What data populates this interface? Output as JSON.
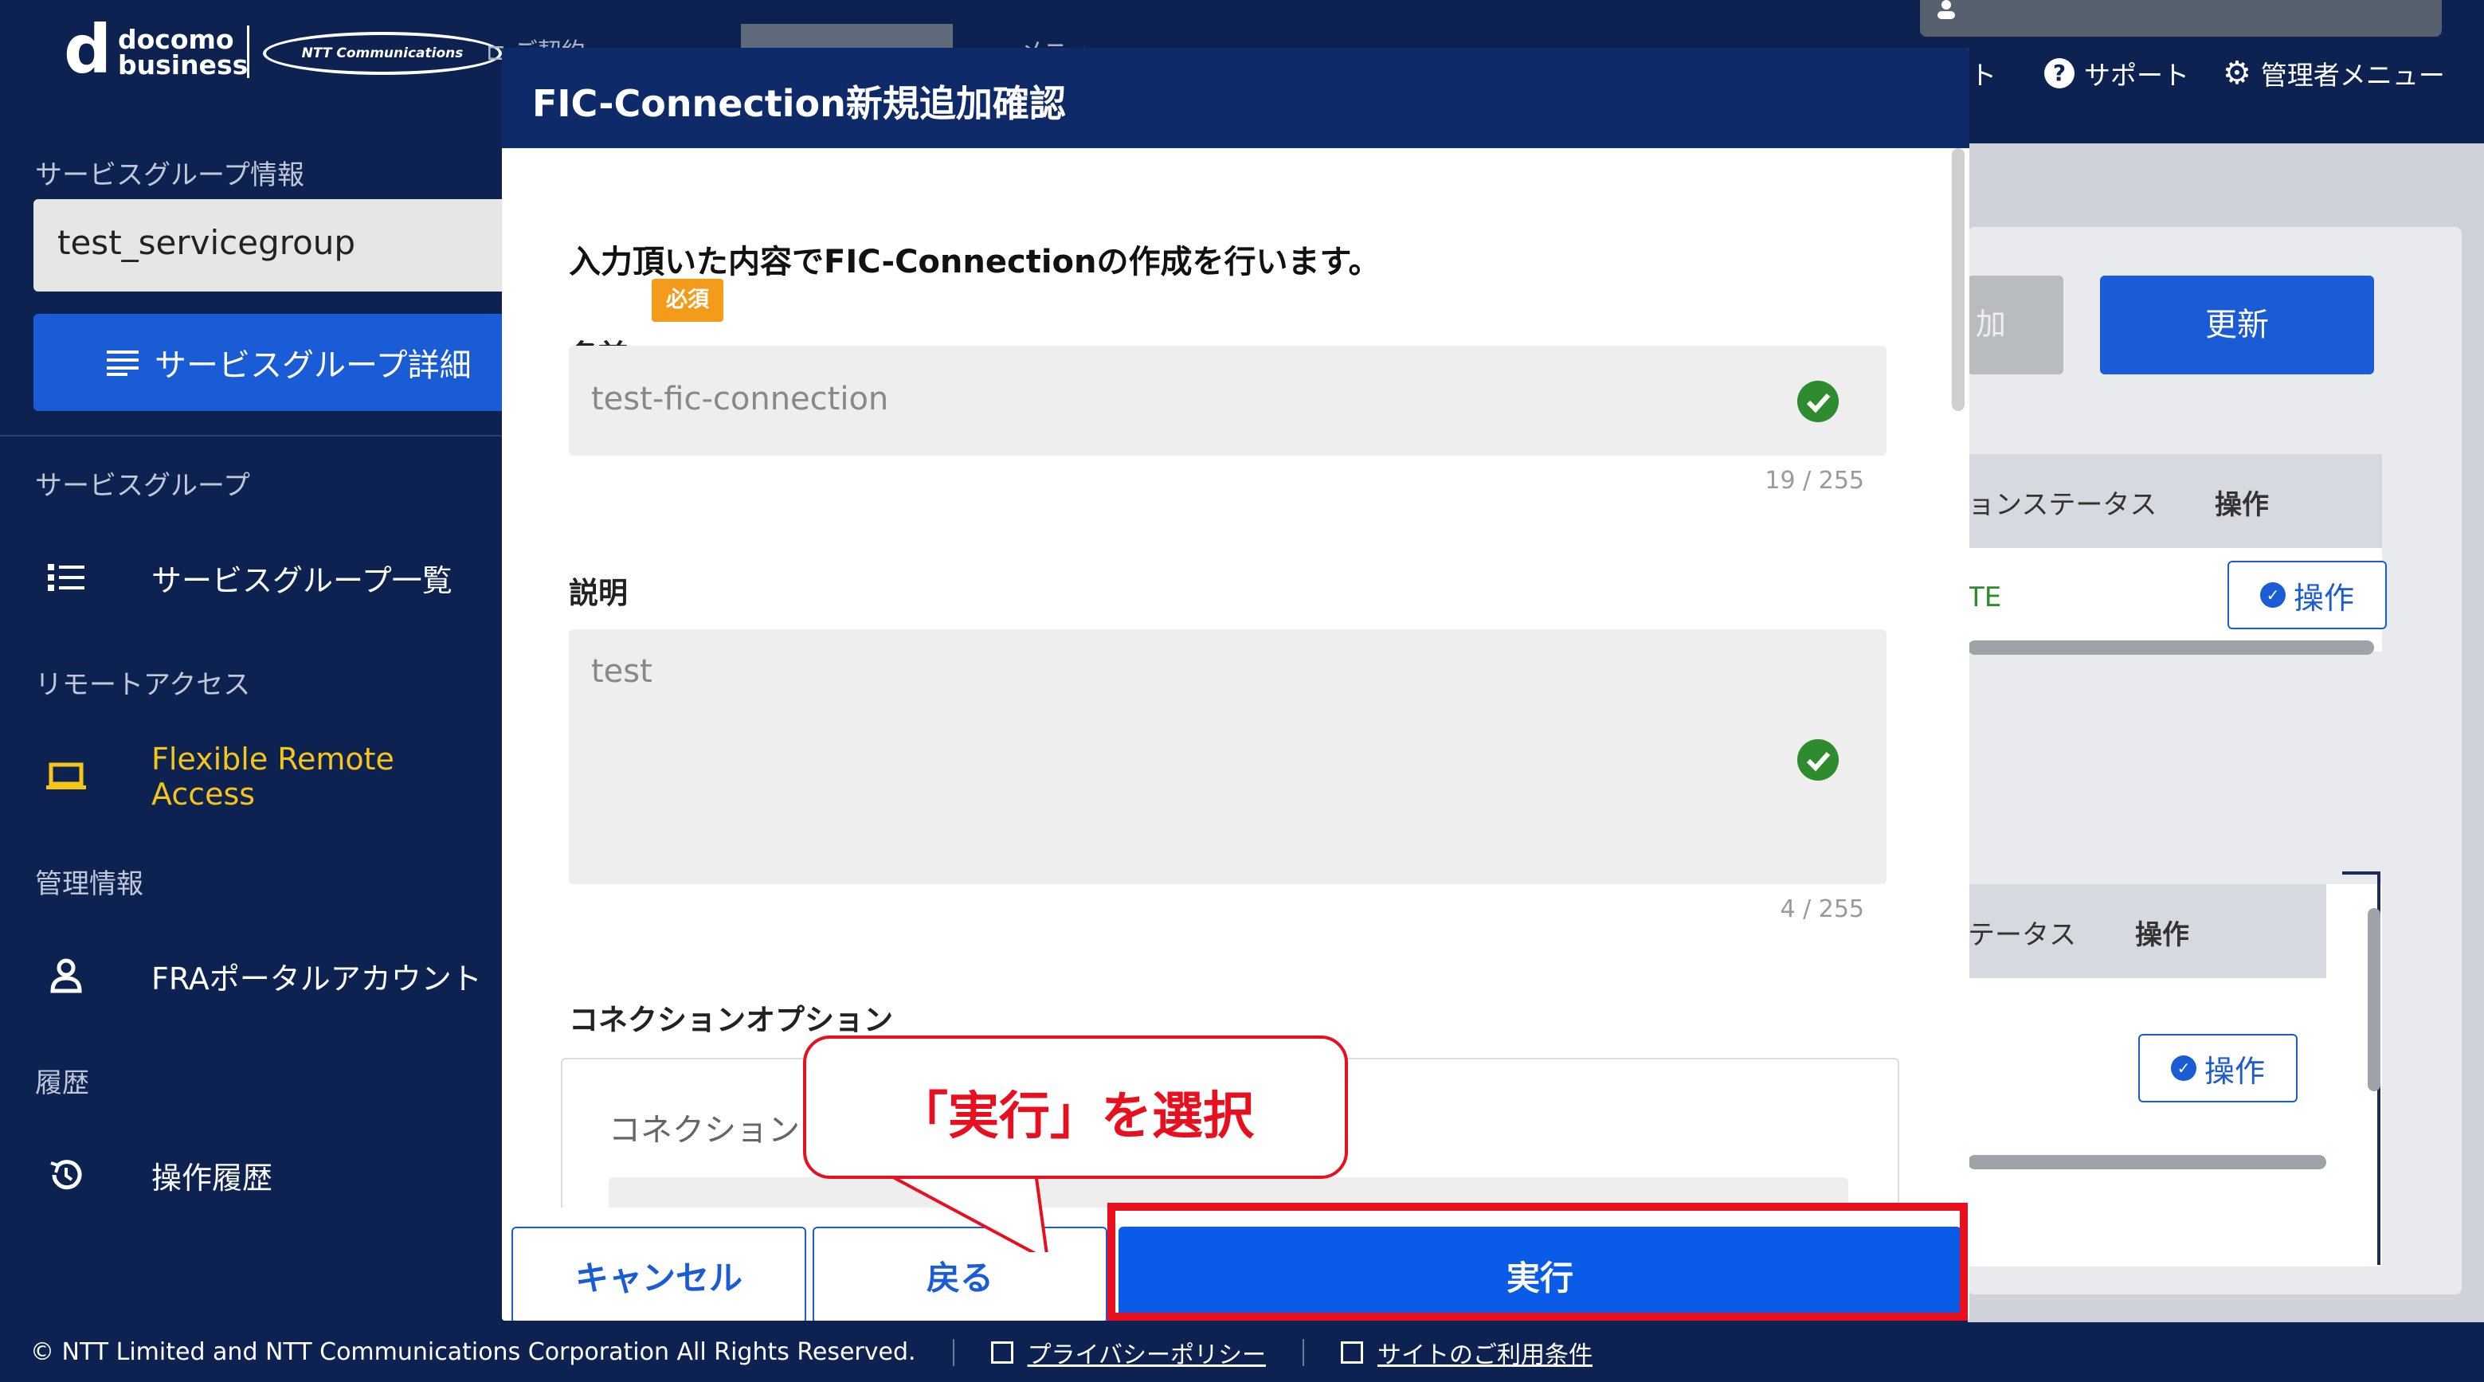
{
  "header": {
    "brand_line1": "docomo",
    "brand_line2": "business",
    "partner_logo": "NTT Communications",
    "nav_fragment1": "ご契約",
    "nav_fragment2": "メニュー",
    "support": "サポート",
    "admin_menu": "管理者メニュー",
    "left_partial": "スト"
  },
  "sidebar": {
    "service_group_info_heading": "サービスグループ情報",
    "selected_group": "test_servicegroup",
    "detail_button": "サービスグループ詳細",
    "sections": [
      {
        "heading": "サービスグループ",
        "items": [
          {
            "label": "サービスグループ一覧",
            "icon": "list-icon"
          }
        ]
      },
      {
        "heading": "リモートアクセス",
        "items": [
          {
            "label": "Flexible Remote Access",
            "icon": "laptop-icon",
            "active": true
          }
        ]
      },
      {
        "heading": "管理情報",
        "items": [
          {
            "label": "FRAポータルアカウント",
            "icon": "person-icon"
          }
        ]
      },
      {
        "heading": "履歴",
        "items": [
          {
            "label": "操作履歴",
            "icon": "history-icon"
          }
        ]
      }
    ]
  },
  "background_page": {
    "add_button_partial": "加",
    "update_button": "更新",
    "table1_col_status_partial": "ョンステータス",
    "table1_col_ops": "操作",
    "table1_row_status_partial": "TE",
    "table2_col_status_partial": "テータス",
    "table2_col_ops": "操作",
    "ops_button": "操作"
  },
  "modal": {
    "title": "FIC-Connection新規追加確認",
    "intro": "入力頂いた内容でFIC-Connectionの作成を行います。",
    "name_label": "名前",
    "required_badge": "必須",
    "name_value": "test-fic-connection",
    "name_counter": "19 / 255",
    "description_label": "説明",
    "description_value": "test",
    "description_counter": "4 / 255",
    "connection_options_label": "コネクションオプション",
    "connection_sub_label": "コネクション",
    "cancel_button": "キャンセル",
    "back_button": "戻る",
    "execute_button": "実行"
  },
  "annotation": {
    "callout_text": "「実行」を選択",
    "highlight_color": "#e8101e"
  },
  "footer": {
    "copyright": "© NTT Limited and NTT Communications Corporation All Rights Reserved.",
    "privacy_link": "プライバシーポリシー",
    "terms_link": "サイトのご利用条件"
  },
  "colors": {
    "navy": "#0d2250",
    "modal_header": "#0e2a68",
    "primary_blue": "#0a5be8",
    "required_orange": "#f59b1c",
    "success_green": "#2e8b2e",
    "active_yellow": "#f5c518"
  }
}
